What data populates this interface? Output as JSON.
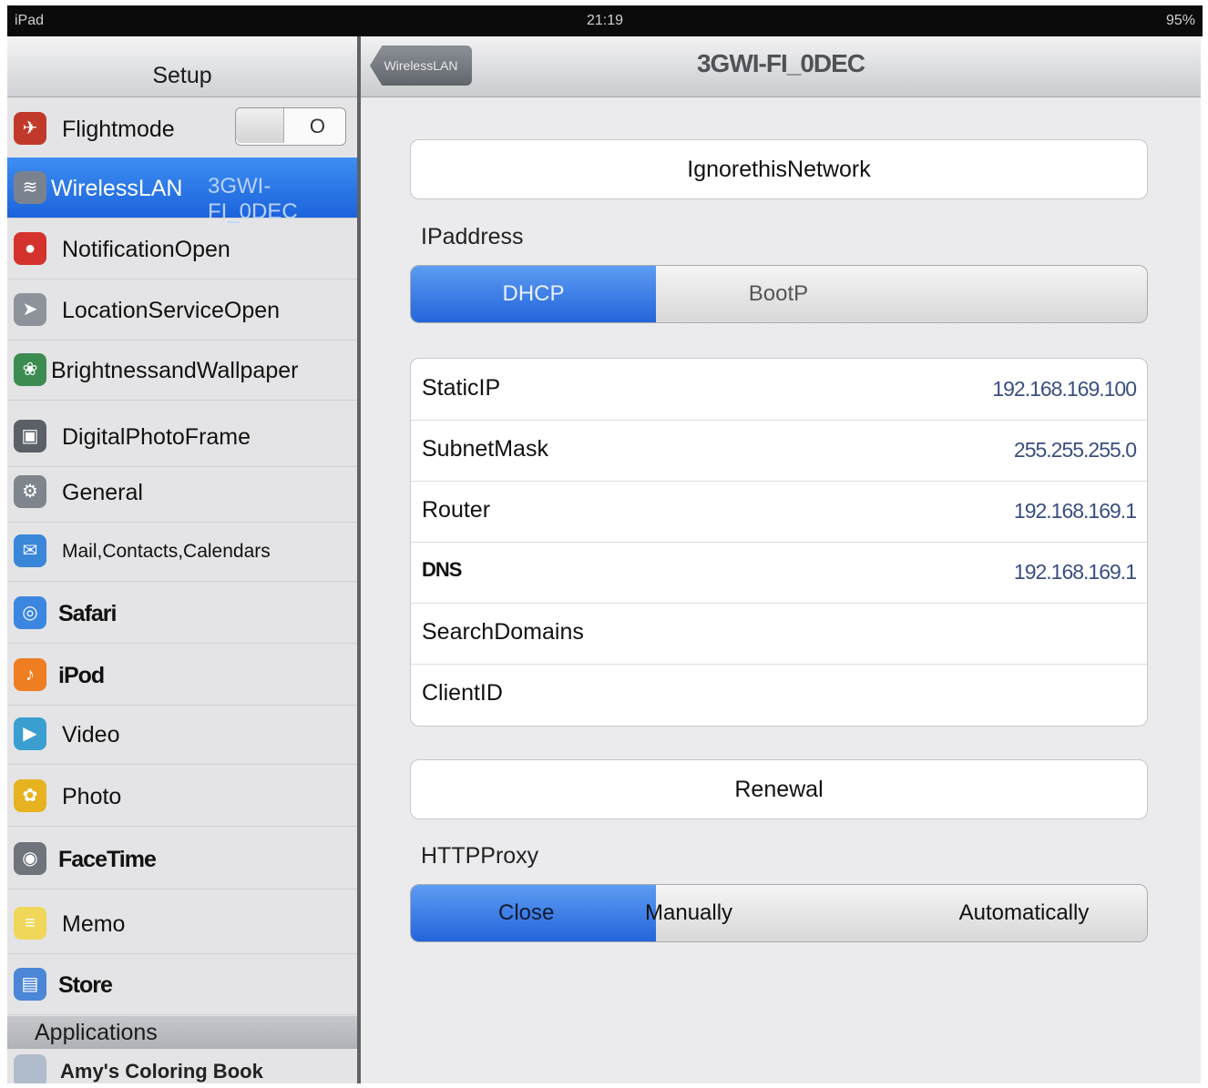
{
  "status_bar": {
    "left": "iPad",
    "time": "21:19",
    "battery": "95%"
  },
  "sidebar": {
    "title": "Setup",
    "flight_toggle_state": "O",
    "items": [
      {
        "label": "Flightmode",
        "icon": "airplane-icon",
        "color": "#c0392b"
      },
      {
        "label": "WirelessLAN",
        "icon": "wifi-icon",
        "color": "#7a8290",
        "sub": "3GWI-FI_0DEC"
      },
      {
        "label": "NotificationOpen",
        "icon": "notification-icon",
        "color": "#d4322c"
      },
      {
        "label": "LocationServiceOpen",
        "icon": "location-icon",
        "color": "#8e939b"
      },
      {
        "label": "BrightnessandWallpaper",
        "icon": "wallpaper-icon",
        "color": "#3c8c52"
      },
      {
        "label": "DigitalPhotoFrame",
        "icon": "photo-frame-icon",
        "color": "#5b6068"
      },
      {
        "label": "General",
        "icon": "gear-icon",
        "color": "#7f858d"
      },
      {
        "label": "Mail,Contacts,Calendars",
        "icon": "mail-icon",
        "color": "#3a86d8"
      },
      {
        "label": "Safari",
        "icon": "safari-icon",
        "color": "#3b86e0"
      },
      {
        "label": "iPod",
        "icon": "ipod-icon",
        "color": "#ef7d22"
      },
      {
        "label": "Video",
        "icon": "video-icon",
        "color": "#3a9fd0"
      },
      {
        "label": "Photo",
        "icon": "photo-icon",
        "color": "#e6b21f"
      },
      {
        "label": "FaceTime",
        "icon": "facetime-icon",
        "color": "#6f747c"
      },
      {
        "label": "Memo",
        "icon": "memo-icon",
        "color": "#f0d75a"
      },
      {
        "label": "Store",
        "icon": "store-icon",
        "color": "#4c86d6"
      }
    ],
    "section_applications": "Applications",
    "partial_app": "Amy's Coloring Book"
  },
  "navbar": {
    "back_label": "WirelessLAN",
    "title": "3GWI-FI_0DEC"
  },
  "main": {
    "ignore_button": "IgnorethisNetwork",
    "ip_section_label": "IPaddress",
    "ip_modes": [
      "DHCP",
      "BootP",
      ""
    ],
    "ip_mode_selected": "DHCP",
    "ip_rows": [
      {
        "key": "StaticIP",
        "value": "192.168.169.100"
      },
      {
        "key": "SubnetMask",
        "value": "255.255.255.0"
      },
      {
        "key": "Router",
        "value": "192.168.169.1"
      },
      {
        "key": "DNS",
        "value": "192.168.169.1"
      },
      {
        "key": "SearchDomains",
        "value": ""
      },
      {
        "key": "ClientID",
        "value": ""
      }
    ],
    "renew_button": "Renewal",
    "proxy_label": "HTTPProxy",
    "proxy_modes": [
      "Close",
      "Manually",
      "Automatically"
    ],
    "proxy_selected": "Close"
  }
}
